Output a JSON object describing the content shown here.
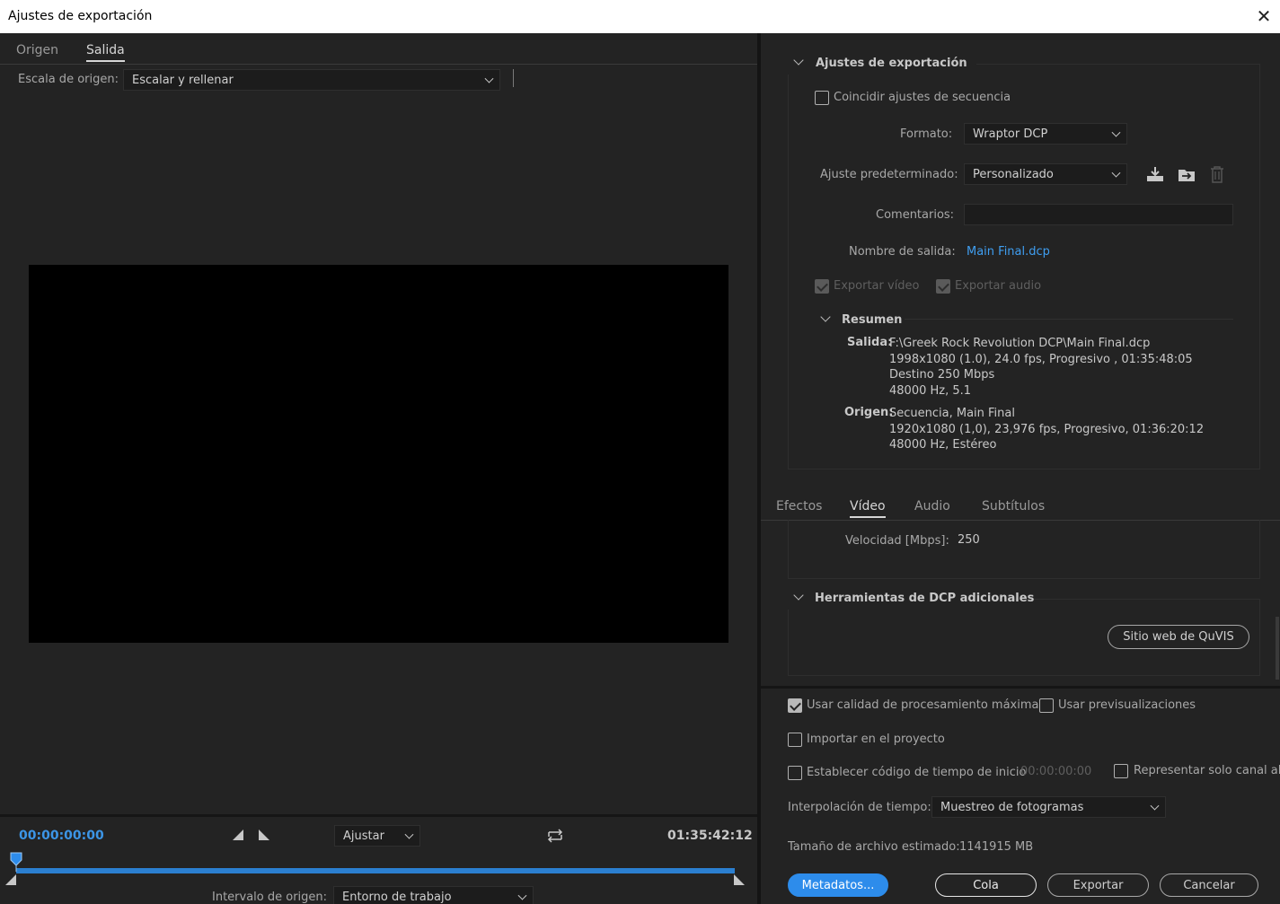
{
  "window": {
    "title": "Ajustes de exportación"
  },
  "left": {
    "tabs": [
      "Origen",
      "Salida"
    ],
    "scale_label": "Escala de origen:",
    "scale_value": "Escalar y rellenar",
    "timeline": {
      "current_time": "00:00:00:00",
      "fit_value": "Ajustar",
      "duration": "01:35:42:12",
      "range_label": "Intervalo de origen:",
      "range_value": "Entorno de trabajo",
      "playhead_progress": 0.0
    }
  },
  "export_settings": {
    "header": "Ajustes de exportación",
    "match_sequence": "Coincidir ajustes de secuencia",
    "format_label": "Formato:",
    "format_value": "Wraptor DCP",
    "preset_label": "Ajuste predeterminado:",
    "preset_value": "Personalizado",
    "comments_label": "Comentarios:",
    "comments_value": "",
    "output_name_label": "Nombre de salida:",
    "output_name_value": "Main Final.dcp",
    "export_video": "Exportar vídeo",
    "export_audio": "Exportar audio",
    "summary": {
      "header": "Resumen",
      "output_label": "Salida:",
      "output_lines": [
        "F:\\Greek Rock Revolution DCP\\Main Final.dcp",
        "1998x1080 (1.0), 24.0 fps, Progresivo , 01:35:48:05",
        "Destino 250 Mbps",
        "48000 Hz, 5.1"
      ],
      "source_label": "Origen:",
      "source_lines": [
        "Secuencia, Main Final",
        "1920x1080 (1,0), 23,976 fps, Progresivo, 01:36:20:12",
        "48000 Hz, Estéreo"
      ]
    }
  },
  "settings_tabs": [
    "Efectos",
    "Vídeo",
    "Audio",
    "Subtítulos"
  ],
  "video": {
    "bitrate_label": "Velocidad [Mbps]:",
    "bitrate_value": "250"
  },
  "dcp_tools": {
    "header": "Herramientas de DCP adicionales",
    "quvis_button": "Sitio web de QuVIS"
  },
  "bottom": {
    "max_quality": "Usar calidad de procesamiento máxima",
    "use_previews": "Usar previsualizaciones",
    "import_project": "Importar en el proyecto",
    "set_start_tc": "Establecer código de tiempo de inicio",
    "start_tc_value": "00:00:00:00",
    "alpha_only": "Representar solo canal alfa",
    "interp_label": "Interpolación de tiempo:",
    "interp_value": "Muestreo de fotogramas",
    "filesize_label": "Tamaño de archivo estimado:",
    "filesize_value": "1141915 MB",
    "buttons": {
      "metadata": "Metadatos...",
      "queue": "Cola",
      "export": "Exportar",
      "cancel": "Cancelar"
    }
  },
  "colors": {
    "accent": "#2d8ceb",
    "link": "#3f9ef1",
    "background": "#232323"
  }
}
